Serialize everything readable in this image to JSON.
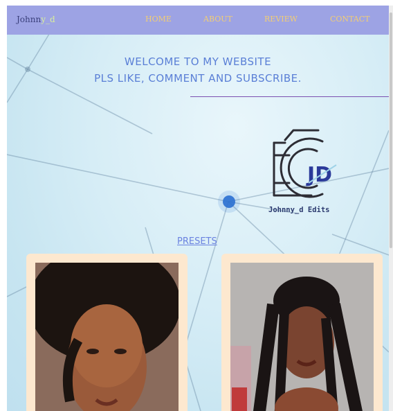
{
  "navbar": {
    "brand_part1": "Johnn",
    "brand_part2": "y_d",
    "links": [
      "HOME",
      "ABOUT",
      "REVIEW",
      "CONTACT"
    ]
  },
  "hero": {
    "line1": "WELCOME TO MY WEBSITE",
    "line2": "PLS LIKE, COMMENT AND SUBSCRIBE."
  },
  "logo": {
    "monogram": "JD",
    "caption": "Johnny_d Edits"
  },
  "presets_label": "PRESETS",
  "colors": {
    "navbar": "#9da3e4",
    "nav_link": "#f2cd74",
    "brand_accent": "#d9ef9b",
    "hero_text": "#5a7fd6",
    "card": "#fde8cf"
  }
}
